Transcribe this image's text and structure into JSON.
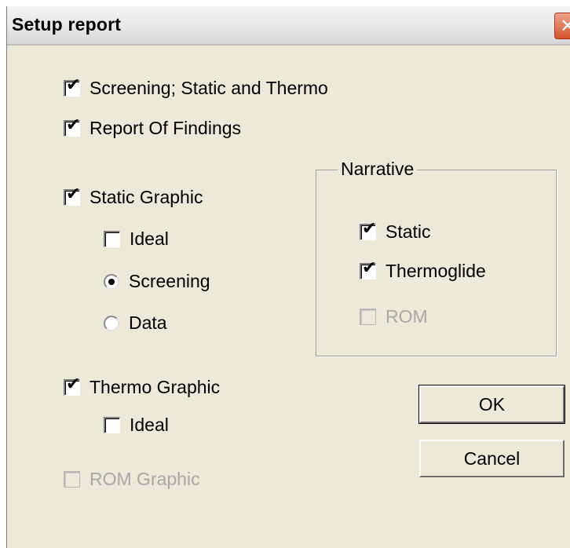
{
  "window": {
    "title": "Setup report",
    "close_glyph": "✕"
  },
  "options": {
    "screening": {
      "label": "Screening; Static and Thermo",
      "checked": true
    },
    "report_of_findings": {
      "label": "Report Of Findings",
      "checked": true
    },
    "static_graphic": {
      "label": "Static Graphic",
      "checked": true
    },
    "static_ideal": {
      "label": "Ideal",
      "checked": false
    },
    "radio_screening": {
      "label": "Screening",
      "selected": true
    },
    "radio_data": {
      "label": "Data",
      "selected": false
    },
    "thermo_graphic": {
      "label": "Thermo Graphic",
      "checked": true
    },
    "thermo_ideal": {
      "label": "Ideal",
      "checked": false
    },
    "rom_graphic": {
      "label": "ROM Graphic",
      "checked": false,
      "enabled": false
    }
  },
  "narrative": {
    "label": "Narrative",
    "static": {
      "label": "Static",
      "checked": true
    },
    "thermoglide": {
      "label": "Thermoglide",
      "checked": true
    },
    "rom": {
      "label": "ROM",
      "checked": false,
      "enabled": false
    }
  },
  "buttons": {
    "ok": "OK",
    "cancel": "Cancel"
  },
  "icons": {
    "check": "✔",
    "check_icon_name": "checkmark-icon",
    "close_icon_name": "close-icon"
  },
  "colors": {
    "face": "#ece9d8",
    "disabled_text": "#a8a8a8",
    "close_red": "#d6532c"
  }
}
